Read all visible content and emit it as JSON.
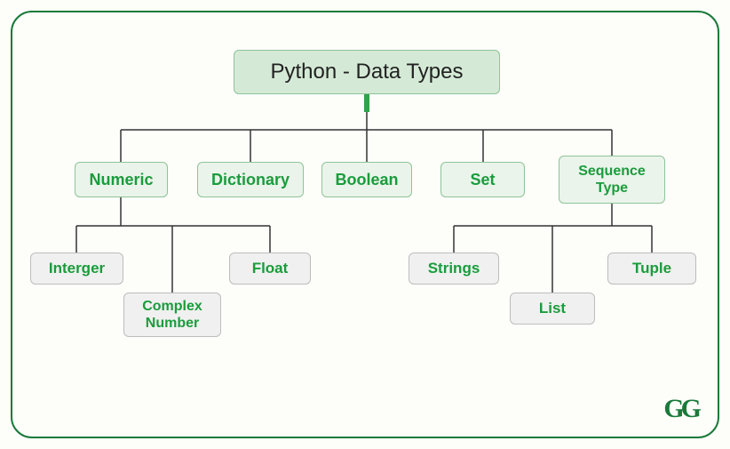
{
  "root": {
    "label": "Python - Data Types"
  },
  "categories": {
    "numeric": {
      "label": "Numeric"
    },
    "dictionary": {
      "label": "Dictionary"
    },
    "boolean": {
      "label": "Boolean"
    },
    "set": {
      "label": "Set"
    },
    "sequence": {
      "label": "Sequence\nType"
    }
  },
  "numeric_children": {
    "integer": {
      "label": "Interger"
    },
    "complex": {
      "label": "Complex\nNumber"
    },
    "float": {
      "label": "Float"
    }
  },
  "sequence_children": {
    "strings": {
      "label": "Strings"
    },
    "list": {
      "label": "List"
    },
    "tuple": {
      "label": "Tuple"
    }
  },
  "logo": "GG"
}
